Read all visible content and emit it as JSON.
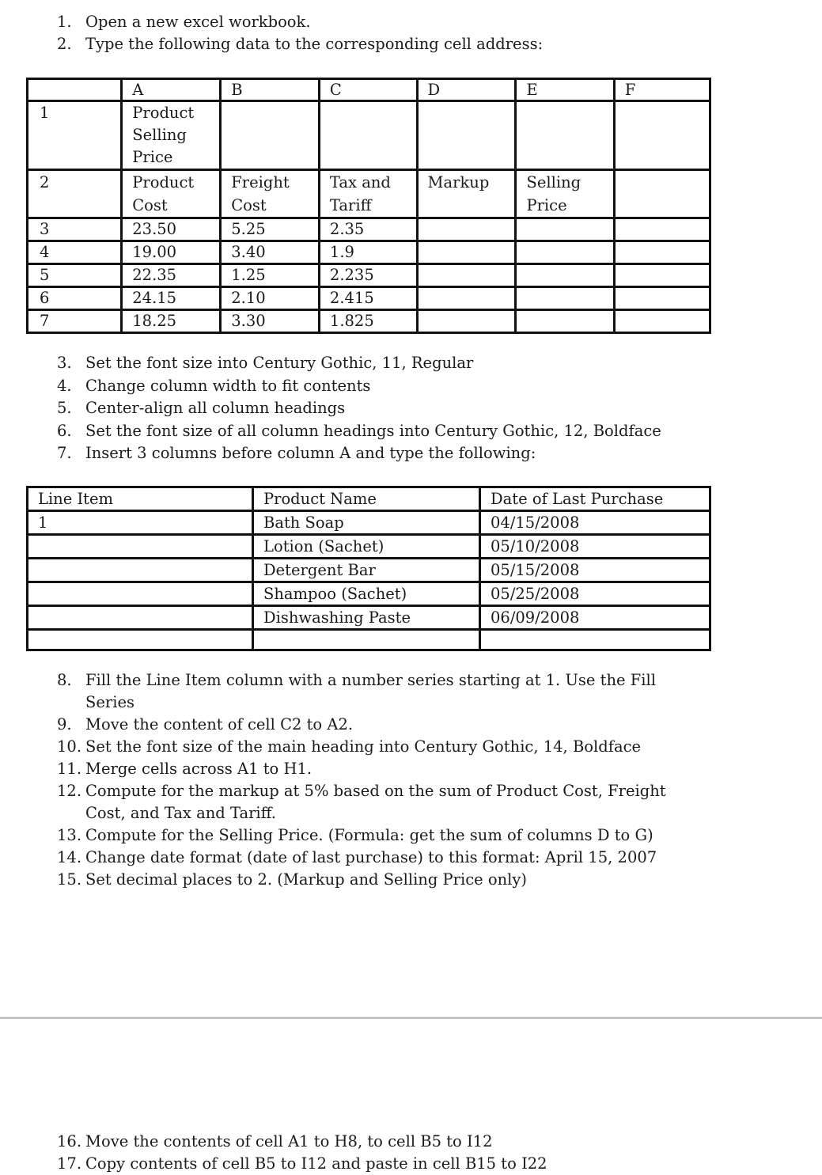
{
  "instructions_part1": [
    {
      "num": "1.",
      "text": "Open a new excel workbook."
    },
    {
      "num": "2.",
      "text": "Type the following data to the corresponding cell address:"
    }
  ],
  "table1": {
    "column_headers": [
      "",
      "A",
      "B",
      "C",
      "D",
      "E",
      "F"
    ],
    "rows": [
      {
        "row": "1",
        "cells": [
          "Product Selling Price",
          "",
          "",
          "",
          "",
          ""
        ]
      },
      {
        "row": "2",
        "cells": [
          "Product Cost",
          "Freight Cost",
          "Tax and Tariff",
          "Markup",
          "Selling Price",
          ""
        ]
      },
      {
        "row": "3",
        "cells": [
          "23.50",
          "5.25",
          "2.35",
          "",
          "",
          ""
        ]
      },
      {
        "row": "4",
        "cells": [
          "19.00",
          "3.40",
          "1.9",
          "",
          "",
          ""
        ]
      },
      {
        "row": "5",
        "cells": [
          "22.35",
          "1.25",
          "2.235",
          "",
          "",
          ""
        ]
      },
      {
        "row": "6",
        "cells": [
          "24.15",
          "2.10",
          "2.415",
          "",
          "",
          ""
        ]
      },
      {
        "row": "7",
        "cells": [
          "18.25",
          "3.30",
          "1.825",
          "",
          "",
          ""
        ]
      }
    ]
  },
  "instructions_part2": [
    {
      "num": "3.",
      "text": "Set the font size into Century Gothic, 11, Regular"
    },
    {
      "num": "4.",
      "text": "Change column width to fit contents"
    },
    {
      "num": "5.",
      "text": "Center-align all column headings"
    },
    {
      "num": "6.",
      "text": "Set the font size of all column headings into Century Gothic, 12, Boldface"
    },
    {
      "num": "7.",
      "text": "Insert 3 columns before column A and type the following:"
    }
  ],
  "table2": {
    "headers": [
      "Line Item",
      "Product Name",
      "Date of Last Purchase"
    ],
    "rows": [
      [
        "1",
        "Bath Soap",
        "04/15/2008"
      ],
      [
        "",
        "Lotion (Sachet)",
        "05/10/2008"
      ],
      [
        "",
        "Detergent Bar",
        "05/15/2008"
      ],
      [
        "",
        "Shampoo (Sachet)",
        "05/25/2008"
      ],
      [
        "",
        "Dishwashing Paste",
        "06/09/2008"
      ],
      [
        "",
        "",
        ""
      ]
    ]
  },
  "instructions_part3": [
    {
      "num": "8.",
      "text": "Fill the Line Item column with a number series starting at 1. Use the Fill Series"
    },
    {
      "num": "9.",
      "text": "Move the content of cell C2 to A2."
    },
    {
      "num": "10.",
      "text": " Set the font size of the main heading into Century Gothic, 14, Boldface"
    },
    {
      "num": "11.",
      "text": "Merge cells across A1 to H1."
    },
    {
      "num": "12.",
      "text": "Compute for the markup at 5% based on the sum of Product Cost, Freight Cost, and Tax and Tariff."
    },
    {
      "num": "13.",
      "text": "Compute for the Selling Price. (Formula: get the sum of columns D to G)"
    },
    {
      "num": "14.",
      "text": "Change date format (date of last purchase) to this format: April 15, 2007"
    },
    {
      "num": "15.",
      "text": "Set decimal places to 2. (Markup and Selling Price only)"
    }
  ],
  "instructions_part4": [
    {
      "num": "16.",
      "text": "Move the contents of cell A1 to H8, to cell B5 to I12"
    },
    {
      "num": "17.",
      "text": "Copy contents of cell B5 to I12 and paste in cell B15 to I22"
    }
  ]
}
